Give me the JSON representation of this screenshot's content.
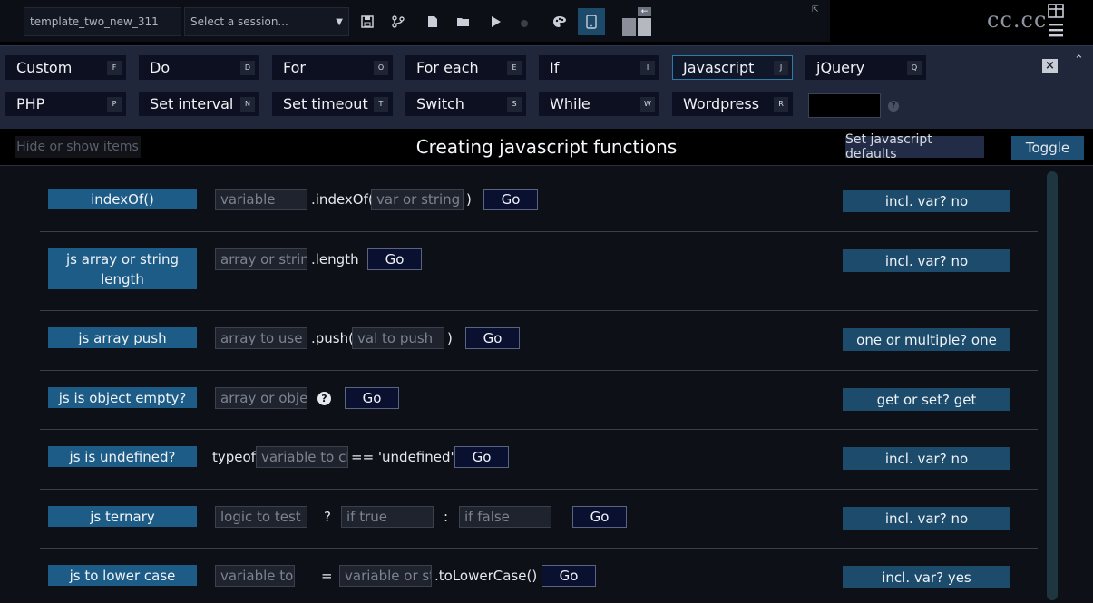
{
  "toolbar": {
    "template_name": "template_two_new_311",
    "session_placeholder": "Select a session...",
    "brand": "cc.cc"
  },
  "shortcuts": [
    {
      "label": "Custom",
      "key": "F"
    },
    {
      "label": "Do",
      "key": "D"
    },
    {
      "label": "For",
      "key": "O"
    },
    {
      "label": "For each",
      "key": "E"
    },
    {
      "label": "If",
      "key": "I"
    },
    {
      "label": "Javascript",
      "key": "J",
      "active": true
    },
    {
      "label": "jQuery",
      "key": "Q"
    },
    {
      "label": "PHP",
      "key": "P"
    },
    {
      "label": "Set interval",
      "key": "N"
    },
    {
      "label": "Set timeout",
      "key": "T"
    },
    {
      "label": "Switch",
      "key": "S"
    },
    {
      "label": "While",
      "key": "W"
    },
    {
      "label": "Wordpress",
      "key": "R"
    }
  ],
  "title_bar": {
    "hide_show": "Hide or show items",
    "title": "Creating javascript functions",
    "defaults": "Set javascript defaults",
    "toggle": "Toggle"
  },
  "functions": [
    {
      "label": "indexOf()",
      "placeholder_1": "variable",
      "text_1": ".indexOf(",
      "placeholder_2": "var or string",
      "text_2": ")",
      "go": "Go",
      "option": "incl. var? no"
    },
    {
      "label": "js array or string length",
      "placeholder_1": "array or string",
      "text_1": ".length",
      "go": "Go",
      "option": "incl. var? no"
    },
    {
      "label": "js array push",
      "placeholder_1": "array to use",
      "text_1": ".push(",
      "placeholder_2": "val to push",
      "text_2": ")",
      "go": "Go",
      "option": "one or multiple? one"
    },
    {
      "label": "js is object empty?",
      "placeholder_1": "array or object",
      "help": "?",
      "go": "Go",
      "option": "get or set? get"
    },
    {
      "label": "js is undefined?",
      "text_0": "typeof",
      "placeholder_1": "variable to check",
      "text_1": "== 'undefined'",
      "go": "Go",
      "option": "incl. var? no"
    },
    {
      "label": "js ternary",
      "placeholder_1": "logic to test",
      "text_1": "?",
      "placeholder_2": "if true",
      "text_2": ":",
      "placeholder_3": "if false",
      "go": "Go",
      "option": "incl. var? no"
    },
    {
      "label": "js to lower case",
      "placeholder_1": "variable to set",
      "text_1": "=",
      "placeholder_2": "variable or string",
      "text_2": ".toLowerCase()",
      "go": "Go",
      "option": "incl. var? yes"
    }
  ]
}
